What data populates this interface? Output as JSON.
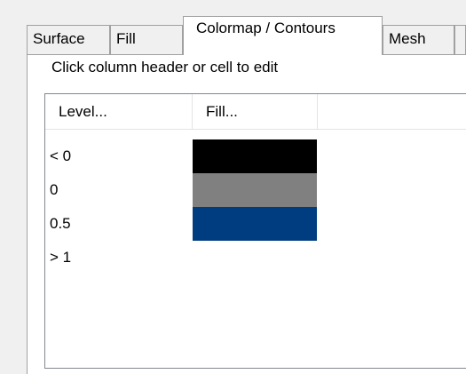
{
  "tabs": [
    {
      "label": "Surface",
      "active": false
    },
    {
      "label": "Fill",
      "active": false
    },
    {
      "label": "Colormap / Contours",
      "active": true
    },
    {
      "label": "Mesh",
      "active": false
    },
    {
      "label": "",
      "active": false
    }
  ],
  "hint": "Click column header or cell to edit",
  "grid": {
    "columns": [
      "Level...",
      "Fill..."
    ],
    "rows": [
      {
        "level": "< 0",
        "fill_color": "#000000"
      },
      {
        "level": "0",
        "fill_color": "#808080"
      },
      {
        "level": "0.5",
        "fill_color": "#003c80"
      },
      {
        "level": "> 1",
        "fill_color": null
      }
    ]
  }
}
